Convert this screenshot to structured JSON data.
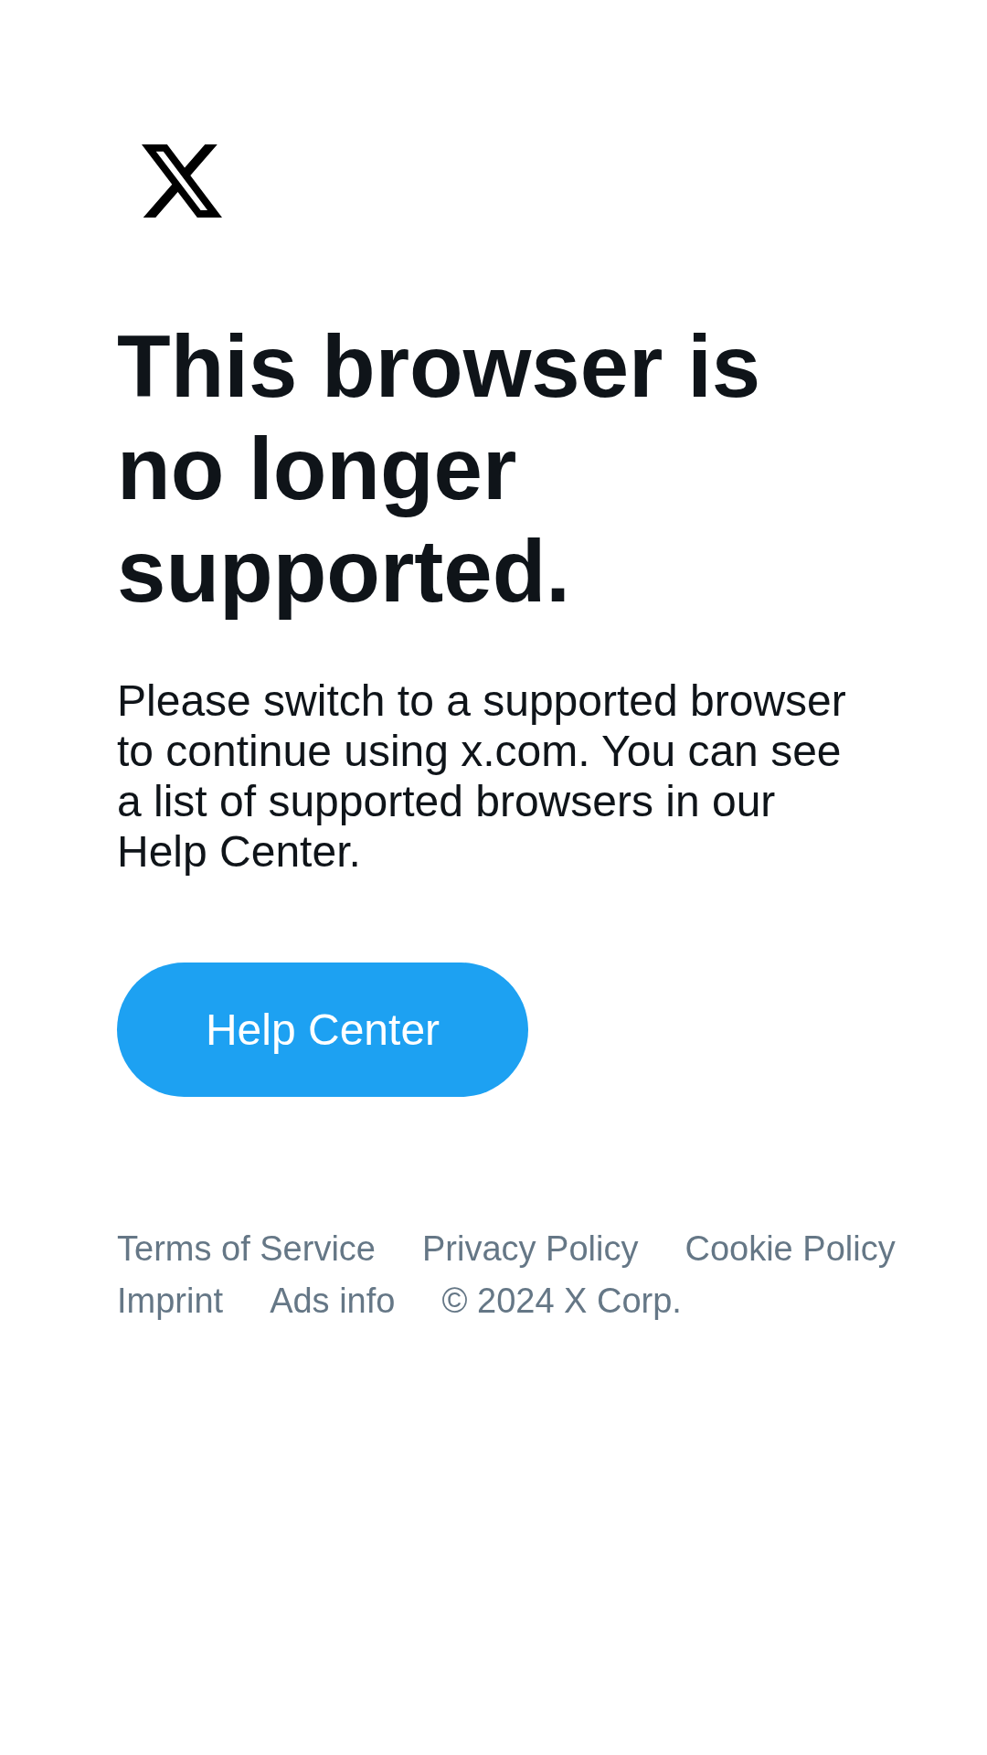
{
  "heading": "This browser is no longer supported.",
  "message": "Please switch to a supported browser to continue using x.com. You can see a list of supported browsers in our Help Center.",
  "button": {
    "label": "Help Center"
  },
  "footer": {
    "links": [
      "Terms of Service",
      "Privacy Policy",
      "Cookie Policy",
      "Imprint",
      "Ads info"
    ],
    "copyright": "© 2024 X Corp."
  }
}
